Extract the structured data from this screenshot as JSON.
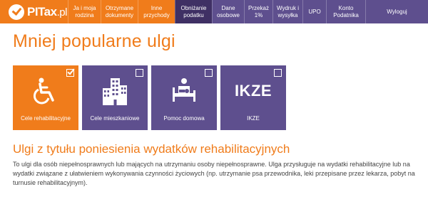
{
  "brand": {
    "name": "PITax",
    "suffix": ".pl"
  },
  "nav": [
    {
      "label": "Ja i moja rodzina"
    },
    {
      "label": "Otrzymane dokumenty"
    },
    {
      "label": "Inne przychody"
    },
    {
      "label": "Obniżanie podatku"
    },
    {
      "label": "Dane osobowe"
    },
    {
      "label": "Przekaż 1%"
    },
    {
      "label": "Wydruk i wysyłka"
    },
    {
      "label": "UPO"
    },
    {
      "label": "Konto Podatnika"
    },
    {
      "label": "Wyloguj"
    }
  ],
  "page": {
    "title": "Mniej popularne ulgi"
  },
  "tiles": [
    {
      "label": "Cele rehabilitacyjne",
      "icon": "wheelchair-icon",
      "selected": true
    },
    {
      "label": "Cele mieszkaniowe",
      "icon": "buildings-icon",
      "selected": false
    },
    {
      "label": "Pomoc domowa",
      "icon": "caregiver-icon",
      "selected": false
    },
    {
      "label": "IKZE",
      "icon_text": "IKZE",
      "selected": false
    }
  ],
  "section": {
    "title": "Ulgi z tytułu poniesienia wydatków rehabilitacyjnych",
    "body": "To ulgi dla osób niepełnosprawnych lub mających na utrzymaniu osoby niepełnosprawne. Ulga przysługuje na wydatki rehabilitacyjne lub na wydatki związane z ułatwieniem wykonywania czynności życiowych (np. utrzymanie psa przewodnika, leki przepisane przez lekarza, pobyt na turnusie rehabilitacyjnym)."
  },
  "colors": {
    "accent": "#f07c1b",
    "purple": "#5e4f8e",
    "active": "#3f3064"
  }
}
